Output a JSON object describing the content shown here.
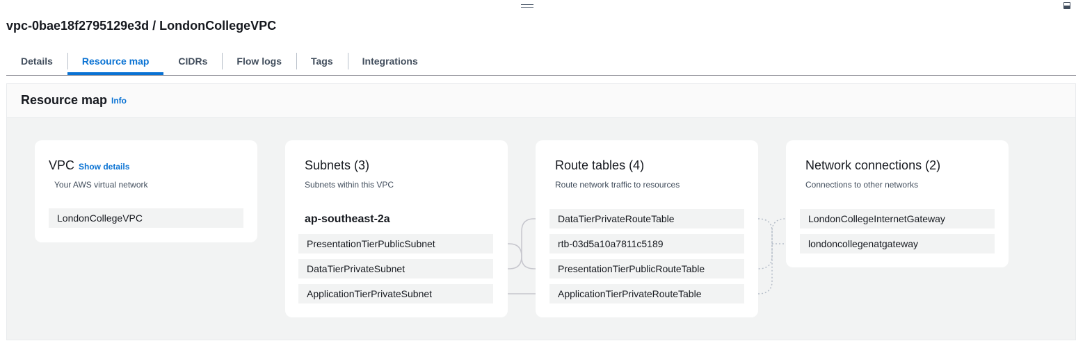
{
  "page": {
    "title": "vpc-0bae18f2795129e3d / LondonCollegeVPC"
  },
  "tabs": [
    {
      "label": "Details",
      "active": false
    },
    {
      "label": "Resource map",
      "active": true
    },
    {
      "label": "CIDRs",
      "active": false
    },
    {
      "label": "Flow logs",
      "active": false
    },
    {
      "label": "Tags",
      "active": false
    },
    {
      "label": "Integrations",
      "active": false
    }
  ],
  "resource_map": {
    "title": "Resource map",
    "info_label": "Info",
    "vpc": {
      "title": "VPC",
      "show_details_label": "Show details",
      "subtitle": "Your AWS virtual network",
      "items": [
        "LondonCollegeVPC"
      ]
    },
    "subnets": {
      "title": "Subnets (3)",
      "subtitle": "Subnets within this VPC",
      "availability_zone": "ap-southeast-2a",
      "items": [
        "PresentationTierPublicSubnet",
        "DataTierPrivateSubnet",
        "ApplicationTierPrivateSubnet"
      ]
    },
    "route_tables": {
      "title": "Route tables (4)",
      "subtitle": "Route network traffic to resources",
      "items": [
        "DataTierPrivateRouteTable",
        "rtb-03d5a10a7811c5189",
        "PresentationTierPublicRouteTable",
        "ApplicationTierPrivateRouteTable"
      ]
    },
    "network_connections": {
      "title": "Network connections (2)",
      "subtitle": "Connections to other networks",
      "items": [
        "LondonCollegeInternetGateway",
        "londoncollegenatgateway"
      ]
    }
  },
  "colors": {
    "accent": "#0972d3",
    "connector_solid": "#c6c6cd",
    "connector_dotted": "#b6bec9",
    "item_background": "#f2f3f3"
  },
  "icons": [
    "drag-handle-icon",
    "split-panel-icon"
  ]
}
